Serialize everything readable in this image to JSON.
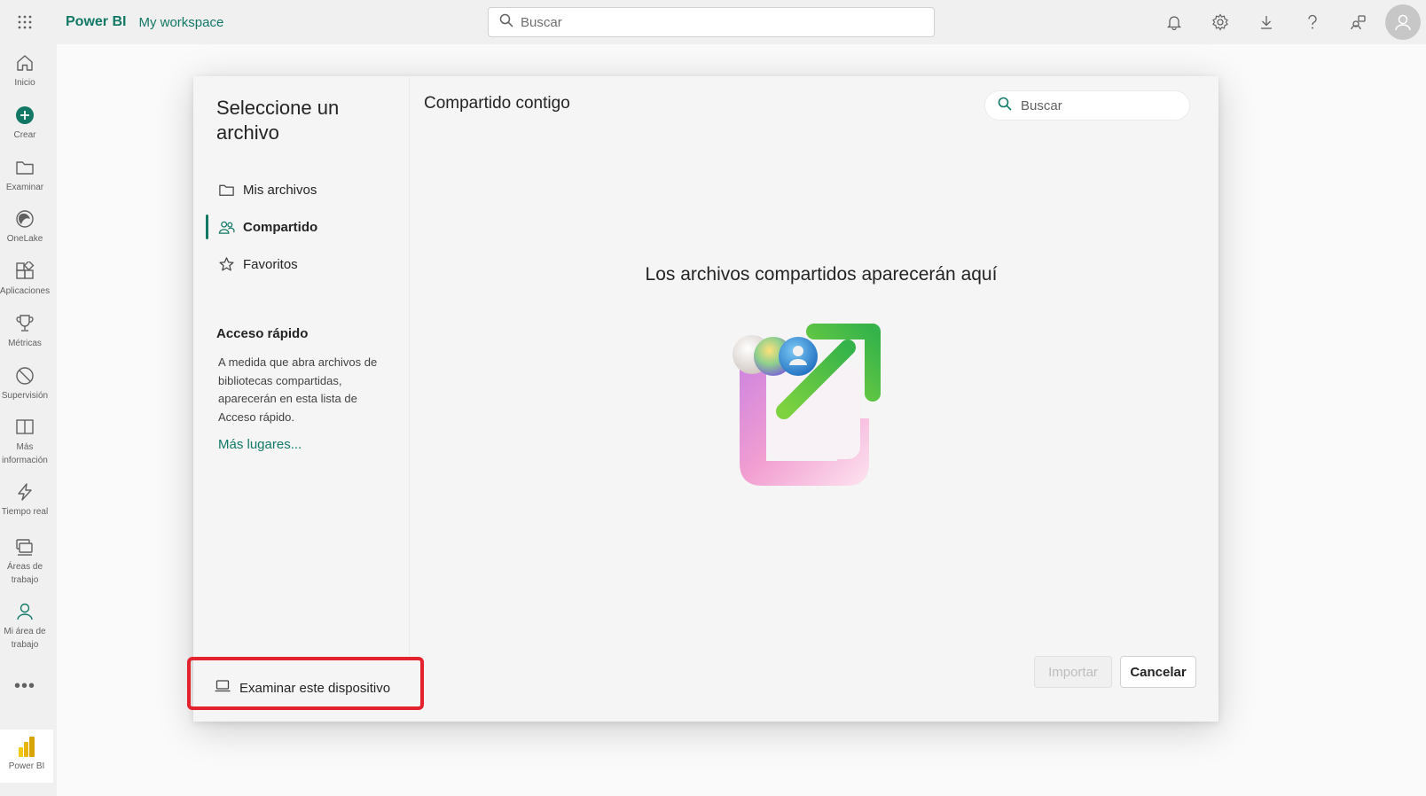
{
  "topbar": {
    "brand": "Power BI",
    "workspace": "My workspace",
    "search_placeholder": "Buscar",
    "icons": [
      "bell-icon",
      "gear-icon",
      "download-icon",
      "help-icon",
      "share-icon"
    ]
  },
  "rail": {
    "items": [
      {
        "label": "Inicio",
        "icon": "home-icon"
      },
      {
        "label": "Crear",
        "icon": "create-plus-icon"
      },
      {
        "label": "Examinar",
        "icon": "folder-icon"
      },
      {
        "label": "OneLake",
        "icon": "onelake-icon"
      },
      {
        "label": "Aplicaciones",
        "icon": "apps-icon"
      },
      {
        "label": "Métricas",
        "icon": "trophy-icon"
      },
      {
        "label": "Supervisión",
        "icon": "monitor-icon"
      },
      {
        "label": "Más\ninformación",
        "icon": "book-icon"
      },
      {
        "label": "Tiempo real",
        "icon": "lightning-icon"
      },
      {
        "label": "Áreas de\ntrabajo",
        "icon": "workspaces-icon"
      },
      {
        "label": "Mi área de\ntrabajo",
        "icon": "my-workspace-icon"
      }
    ],
    "more": "•••",
    "footer_label": "Power BI"
  },
  "dialog": {
    "title": "Seleccione un archivo",
    "nav": [
      {
        "label": "Mis archivos",
        "icon": "folder-icon"
      },
      {
        "label": "Compartido",
        "icon": "people-icon",
        "active": true
      },
      {
        "label": "Favoritos",
        "icon": "star-icon"
      }
    ],
    "quick_access": {
      "title": "Acceso rápido",
      "text": "A medida que abra archivos de bibliotecas compartidas, aparecerán en esta lista de Acceso rápido.",
      "link": "Más lugares..."
    },
    "pane_title": "Compartido contigo",
    "search_placeholder": "Buscar",
    "empty_message": "Los archivos compartidos aparecerán aquí",
    "browse_device": "Examinar este dispositivo",
    "import_label": "Importar",
    "cancel_label": "Cancelar"
  },
  "colors": {
    "accent": "#117865",
    "highlight": "#e4222e"
  }
}
